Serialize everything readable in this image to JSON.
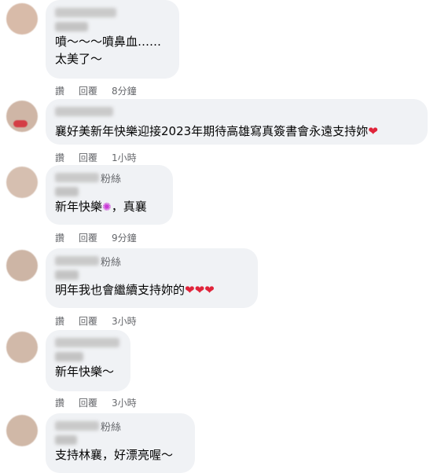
{
  "comments": [
    {
      "lines": [
        "噴～～～噴鼻血……",
        "太美了～"
      ],
      "actions": {
        "like": "讚",
        "reply": "回覆",
        "time": "8分鐘"
      }
    },
    {
      "text": "襄好美新年快樂迎接2023年期待高雄寫真簽書會永遠支持妳",
      "actions": {
        "like": "讚",
        "reply": "回覆",
        "time": "1小時"
      }
    },
    {
      "badge": "粉絲",
      "text": "新年快樂",
      "text_after": "，真襄",
      "actions": {
        "like": "讚",
        "reply": "回覆",
        "time": "9分鐘"
      }
    },
    {
      "badge": "粉絲",
      "text": "明年我也會繼續支持妳的",
      "actions": {
        "like": "讚",
        "reply": "回覆",
        "time": "3小時"
      }
    },
    {
      "text": "新年快樂～",
      "actions": {
        "like": "讚",
        "reply": "回覆",
        "time": "3小時"
      }
    },
    {
      "badge": "粉絲",
      "text": "支持林襄，好漂亮喔～"
    }
  ],
  "emoji": {
    "heart": "❤",
    "sparkle": "✺"
  },
  "colors": {
    "bubble": "#f0f2f5",
    "meta_text": "#65676b",
    "heart": "#e0243a"
  }
}
